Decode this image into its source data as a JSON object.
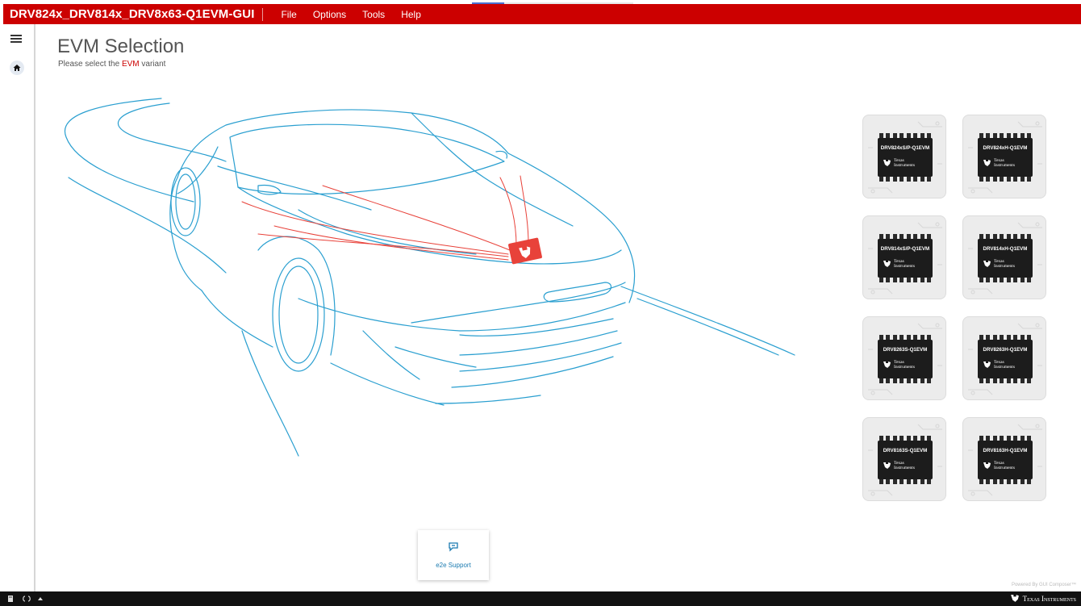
{
  "window": {
    "title": "DRV824x_DRV814x_DRV8x63-Q1EVM-GUI"
  },
  "menu": {
    "items": [
      "File",
      "Options",
      "Tools",
      "Help"
    ]
  },
  "page": {
    "title": "EVM Selection",
    "subtitle_before": "Please select the ",
    "subtitle_highlight": "EVM",
    "subtitle_after": " variant"
  },
  "evm_cards": [
    {
      "label": "DRV824xS/P-Q1EVM"
    },
    {
      "label": "DRV824xH-Q1EVM"
    },
    {
      "label": "DRV814xS/P-Q1EVM"
    },
    {
      "label": "DRV814xH-Q1EVM"
    },
    {
      "label": "DRV8263S-Q1EVM"
    },
    {
      "label": "DRV8263H-Q1EVM"
    },
    {
      "label": "DRV8163S-Q1EVM"
    },
    {
      "label": "DRV8163H-Q1EVM"
    }
  ],
  "chip_brand": {
    "line1": "Texas",
    "line2": "Instruments"
  },
  "support": {
    "label": "e2e Support"
  },
  "footer": {
    "powered_by": "Powered By GUI Composer™",
    "brand": "Texas Instruments"
  },
  "colors": {
    "brand_red": "#cc0000",
    "car_line": "#2a9fd0",
    "accent_red": "#e8423a",
    "footer_bg": "#111111"
  },
  "icons": {
    "nav_menu": "hamburger-icon",
    "nav_home": "home-icon",
    "support": "chat-icon",
    "footer": [
      "book-icon",
      "refresh-icon",
      "chevron-up-icon"
    ]
  }
}
